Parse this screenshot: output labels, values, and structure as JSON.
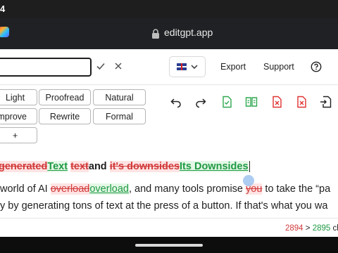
{
  "status_bar": {
    "time": "4"
  },
  "browser": {
    "url": "editgpt.app"
  },
  "toolbar": {
    "language_flag": "🇬🇧",
    "export_label": "Export",
    "support_label": "Support",
    "help_icon": "question-circle-icon",
    "check_icon": "checkmark-icon",
    "close_icon": "x-icon"
  },
  "modes": {
    "row1": [
      "Light",
      "Proofread",
      "Natural"
    ],
    "row2": [
      "Improve",
      "Rewrite",
      "Formal"
    ],
    "add": "+"
  },
  "actions": [
    "undo-icon",
    "redo-icon",
    "accept-all-icon",
    "compare-icon",
    "reject-all-icon",
    "discard-icon",
    "export-doc-icon"
  ],
  "document": {
    "heading": {
      "del1": "generated",
      "ins1": "Text",
      "del2": "text",
      "plain": "and",
      "del3": "it's downsides",
      "ins2": "Its Downsides"
    },
    "line2": {
      "a": " world of AI ",
      "del1": "overload",
      "ins1": "overload",
      "b": ", and many tools promise ",
      "del2": "you",
      "c": " to take the “pa"
    },
    "line3": "y by generating tons of text at the press of a button. If that's what you wa"
  },
  "footer": {
    "before": "2894",
    "sep": " > ",
    "after": "2895",
    "suffix": " ch"
  },
  "colors": {
    "deleted": "#d13a3a",
    "inserted": "#1f9a44",
    "accent_blue": "#9fc3ef"
  }
}
